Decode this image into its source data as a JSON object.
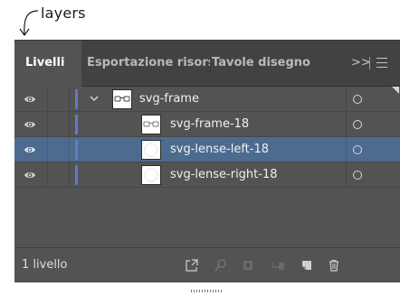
{
  "annotation": {
    "label": "layers"
  },
  "panel": {
    "tabs": [
      {
        "label": "Livelli",
        "active": true
      },
      {
        "label": "Esportazione risors",
        "active": false
      },
      {
        "label": "Tavole disegno",
        "active": false
      }
    ],
    "overflow_label": ">>",
    "colors": {
      "accent_bar": "#5f7bd0",
      "selected_row": "#4d6b8e",
      "panel_bg": "#535353",
      "tab_bar_bg": "#424242"
    },
    "layers": [
      {
        "name": "svg-frame",
        "expanded": true,
        "visible": true,
        "thumbnail": "glasses-thumb",
        "selected": false,
        "level": 0
      },
      {
        "name": "svg-frame-18",
        "visible": true,
        "thumbnail": "glasses-thumb",
        "selected": false,
        "level": 1
      },
      {
        "name": "svg-lense-left-18",
        "visible": true,
        "thumbnail": "lens-thumb",
        "selected": true,
        "level": 1
      },
      {
        "name": "svg-lense-right-18",
        "visible": true,
        "thumbnail": "lens-thumb",
        "selected": false,
        "level": 1
      }
    ],
    "footer": {
      "status": "1 livello",
      "buttons": [
        "export-icon",
        "search-icon",
        "clipping-mask-icon",
        "create-sublayer-icon",
        "new-layer-icon",
        "trash-icon"
      ]
    }
  }
}
